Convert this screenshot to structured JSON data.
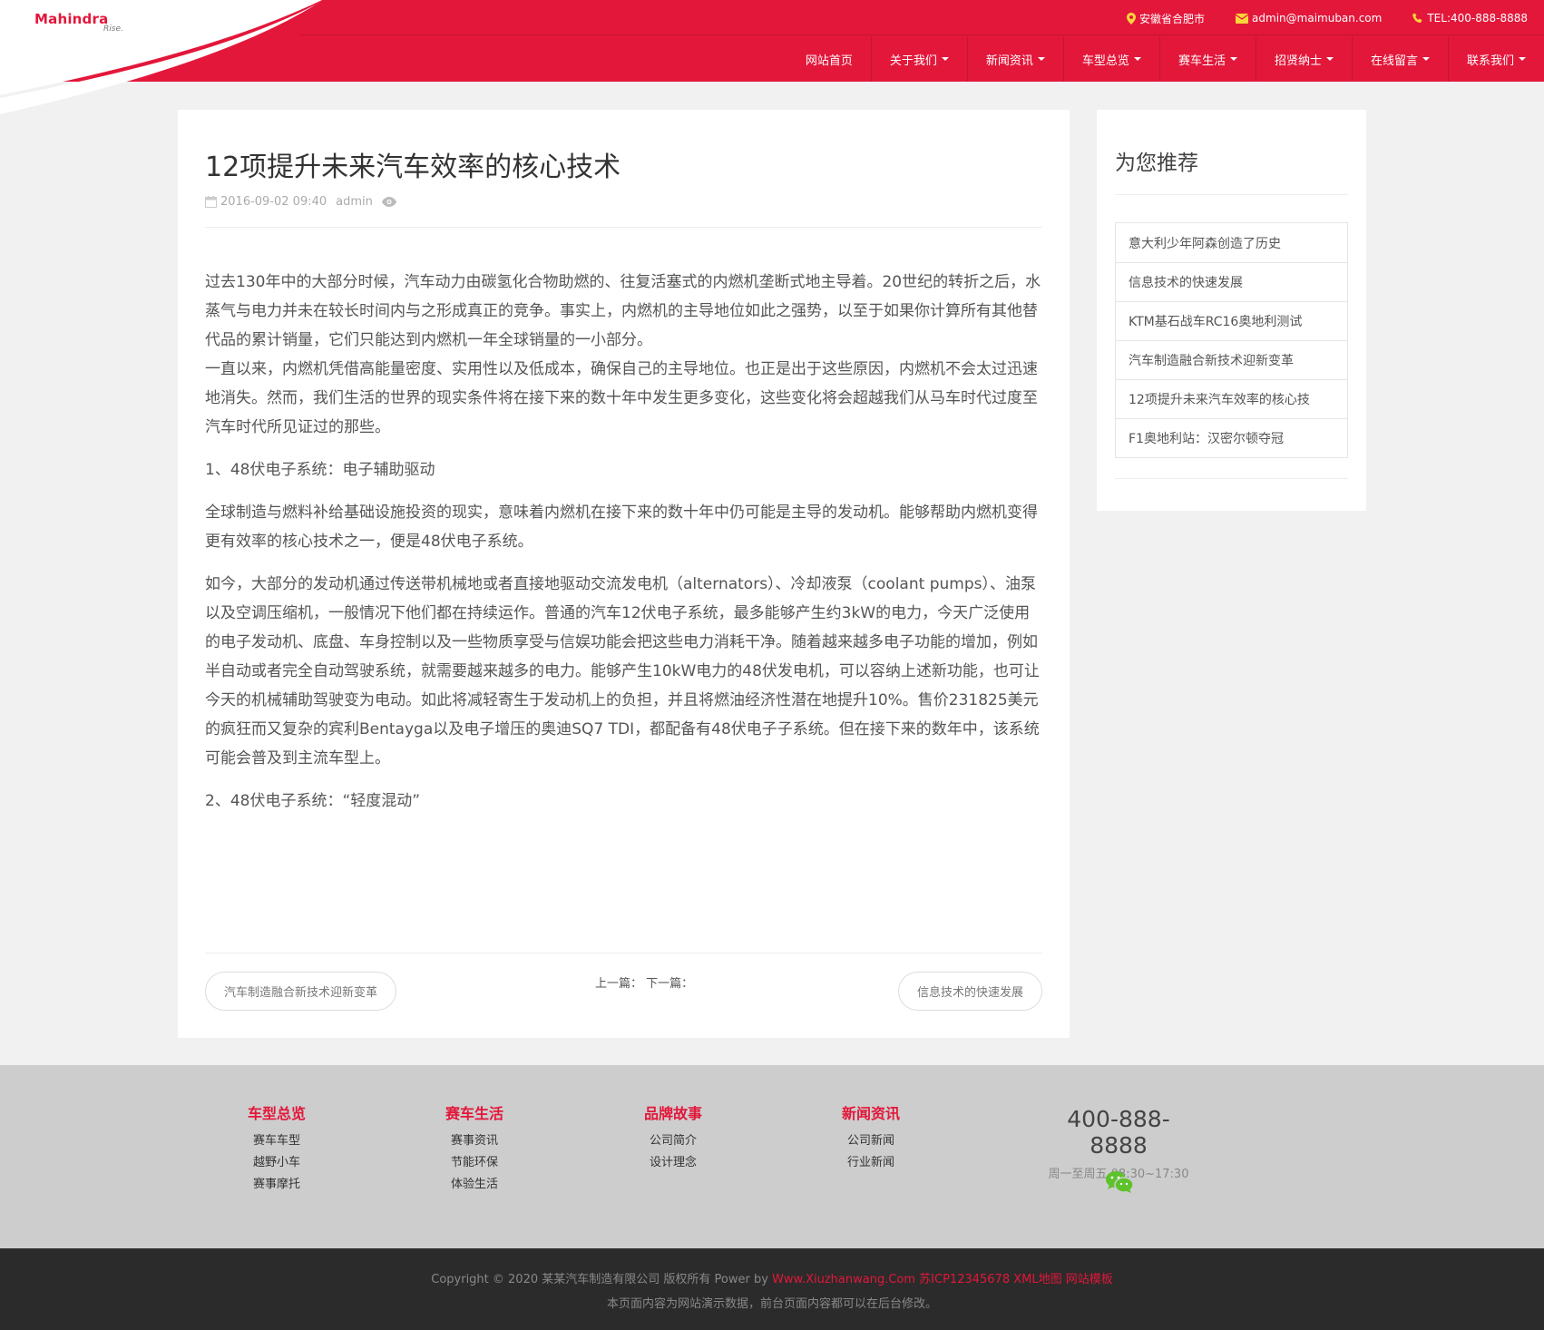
{
  "colors": {
    "brand_red": "#e3173a",
    "footer_bg": "#cdcdcd",
    "bottom_bg": "#2b2b2b"
  },
  "header": {
    "logo": "Mahindra",
    "logo_sub": "Rise.",
    "location": "安徽省合肥市",
    "email": "admin@maimuban.com",
    "tel": "TEL:400-888-8888",
    "nav": [
      {
        "label": "网站首页",
        "dropdown": false
      },
      {
        "label": "关于我们",
        "dropdown": true
      },
      {
        "label": "新闻资讯",
        "dropdown": true
      },
      {
        "label": "车型总览",
        "dropdown": true
      },
      {
        "label": "赛车生活",
        "dropdown": true
      },
      {
        "label": "招贤纳士",
        "dropdown": true
      },
      {
        "label": "在线留言",
        "dropdown": true
      },
      {
        "label": "联系我们",
        "dropdown": true
      }
    ]
  },
  "article": {
    "title": "12项提升未来汽车效率的核心技术",
    "date": "2016-09-02 09:40",
    "author": "admin",
    "paragraphs": [
      "过去130年中的大部分时候，汽车动力由碳氢化合物助燃的、往复活塞式的内燃机垄断式地主导着。20世纪的转折之后，水蒸气与电力并未在较长时间内与之形成真正的竞争。事实上，内燃机的主导地位如此之强势，以至于如果你计算所有其他替代品的累计销量，它们只能达到内燃机一年全球销量的一小部分。",
      "一直以来，内燃机凭借高能量密度、实用性以及低成本，确保自己的主导地位。也正是出于这些原因，内燃机不会太过迅速地消失。然而，我们生活的世界的现实条件将在接下来的数十年中发生更多变化，这些变化将会超越我们从马车时代过度至汽车时代所见证过的那些。",
      "1、48伏电子系统：电子辅助驱动",
      "全球制造与燃料补给基础设施投资的现实，意味着内燃机在接下来的数十年中仍可能是主导的发动机。能够帮助内燃机变得更有效率的核心技术之一，便是48伏电子系统。",
      "如今，大部分的发动机通过传送带机械地或者直接地驱动交流发电机（alternators）、冷却液泵（coolant pumps）、油泵以及空调压缩机，一般情况下他们都在持续运作。普通的汽车12伏电子系统，最多能够产生约3kW的电力，今天广泛使用的电子发动机、底盘、车身控制以及一些物质享受与信娱功能会把这些电力消耗干净。随着越来越多电子功能的增加，例如半自动或者完全自动驾驶系统，就需要越来越多的电力。能够产生10kW电力的48伏发电机，可以容纳上述新功能，也可让今天的机械辅助驾驶变为电动。如此将减轻寄生于发动机上的负担，并且将燃油经济性潜在地提升10%。售价231825美元的疯狂而又复杂的宾利Bentayga以及电子增压的奥迪SQ7 TDI，都配备有48伏电子子系统。但在接下来的数年中，该系统可能会普及到主流车型上。",
      " 2、48伏电子系统：“轻度混动”"
    ],
    "prev_title": "汽车制造融合新技术迎新变革",
    "next_title": "信息技术的快速发展",
    "pager_label": "上一篇：  下一篇："
  },
  "sidebar": {
    "title": "为您推荐",
    "items": [
      "意大利少年阿森创造了历史",
      "信息技术的快速发展",
      "KTM基石战车RC16奥地利测试",
      "汽车制造融合新技术迎新变革",
      "12项提升未来汽车效率的核心技",
      "F1奥地利站：汉密尔顿夺冠"
    ]
  },
  "footer": {
    "columns": [
      {
        "title": "车型总览",
        "links": [
          "赛车车型",
          "越野小车",
          "赛事摩托"
        ]
      },
      {
        "title": "赛车生活",
        "links": [
          "赛事资讯",
          "节能环保",
          "体验生活"
        ]
      },
      {
        "title": "品牌故事",
        "links": [
          "公司简介",
          "设计理念"
        ]
      },
      {
        "title": "新闻资讯",
        "links": [
          "公司新闻",
          "行业新闻"
        ]
      }
    ],
    "phone": "400-888-8888",
    "hours": "周一至周五 08:30~17:30"
  },
  "bottom": {
    "copyright": "Copyright © 2020 某某汽车制造有限公司 版权所有 Power by ",
    "links": "Www.Xiuzhanwang.Com 苏ICP12345678 XML地图 网站模板",
    "notice": "本页面内容为网站演示数据，前台页面内容都可以在后台修改。"
  }
}
